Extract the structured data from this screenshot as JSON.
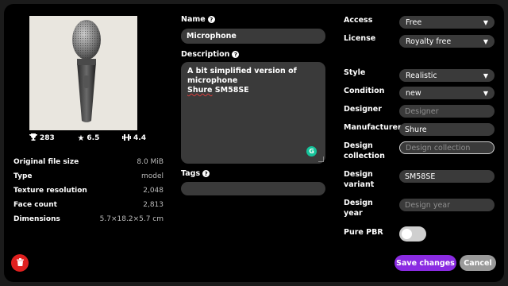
{
  "preview": {
    "stats": [
      {
        "icon": "trophy-icon",
        "value": "283"
      },
      {
        "icon": "star-icon",
        "value": "6.5"
      },
      {
        "icon": "dumbbell-icon",
        "value": "4.4"
      }
    ]
  },
  "file_info": [
    {
      "label": "Original file size",
      "value": "8.0 MiB"
    },
    {
      "label": "Type",
      "value": "model"
    },
    {
      "label": "Texture resolution",
      "value": "2,048"
    },
    {
      "label": "Face count",
      "value": "2,813"
    },
    {
      "label": "Dimensions",
      "value": "5.7×18.2×5.7 cm"
    }
  ],
  "form": {
    "name_label": "Name",
    "name_value": "Microphone",
    "description_label": "Description",
    "description_text_1": "A bit simplified version of microphone",
    "description_text_2a": "Shure",
    "description_text_2b": " SM58SE",
    "tags_label": "Tags",
    "tags_value": ""
  },
  "right": {
    "access_label": "Access",
    "access_value": "Free",
    "license_label": "License",
    "license_value": "Royalty free",
    "style_label": "Style",
    "style_value": "Realistic",
    "condition_label": "Condition",
    "condition_value": "new",
    "designer_label": "Designer",
    "designer_placeholder": "Designer",
    "manufacturer_label": "Manufacturer",
    "manufacturer_value": "Shure",
    "design_collection_label_1": "Design",
    "design_collection_label_2": "collection",
    "design_collection_placeholder": "Design collection",
    "design_variant_label_1": "Design",
    "design_variant_label_2": "variant",
    "design_variant_value": "SM58SE",
    "design_year_label_1": "Design",
    "design_year_label_2": "year",
    "design_year_placeholder": "Design year",
    "pure_pbr_label": "Pure PBR",
    "pure_pbr_on": false
  },
  "actions": {
    "save_label": "Save changes",
    "cancel_label": "Cancel"
  },
  "colors": {
    "accent": "#8a2be2",
    "delete": "#e0201f",
    "field": "#3a3a3a"
  }
}
